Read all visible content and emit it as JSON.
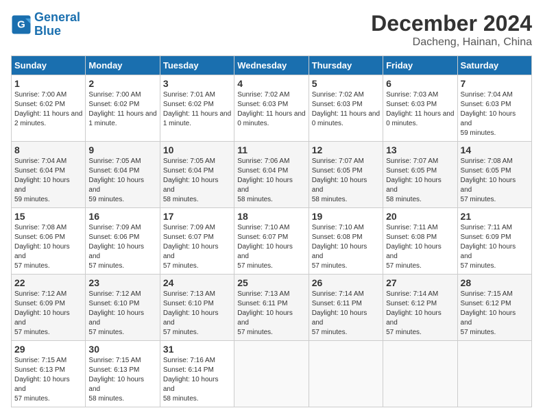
{
  "logo": {
    "line1": "General",
    "line2": "Blue"
  },
  "title": "December 2024",
  "location": "Dacheng, Hainan, China",
  "days_of_week": [
    "Sunday",
    "Monday",
    "Tuesday",
    "Wednesday",
    "Thursday",
    "Friday",
    "Saturday"
  ],
  "weeks": [
    [
      {
        "num": "1",
        "sunrise": "7:00 AM",
        "sunset": "6:02 PM",
        "daylight": "11 hours and 2 minutes."
      },
      {
        "num": "2",
        "sunrise": "7:00 AM",
        "sunset": "6:02 PM",
        "daylight": "11 hours and 1 minute."
      },
      {
        "num": "3",
        "sunrise": "7:01 AM",
        "sunset": "6:02 PM",
        "daylight": "11 hours and 1 minute."
      },
      {
        "num": "4",
        "sunrise": "7:02 AM",
        "sunset": "6:03 PM",
        "daylight": "11 hours and 0 minutes."
      },
      {
        "num": "5",
        "sunrise": "7:02 AM",
        "sunset": "6:03 PM",
        "daylight": "11 hours and 0 minutes."
      },
      {
        "num": "6",
        "sunrise": "7:03 AM",
        "sunset": "6:03 PM",
        "daylight": "11 hours and 0 minutes."
      },
      {
        "num": "7",
        "sunrise": "7:04 AM",
        "sunset": "6:03 PM",
        "daylight": "10 hours and 59 minutes."
      }
    ],
    [
      {
        "num": "8",
        "sunrise": "7:04 AM",
        "sunset": "6:04 PM",
        "daylight": "10 hours and 59 minutes."
      },
      {
        "num": "9",
        "sunrise": "7:05 AM",
        "sunset": "6:04 PM",
        "daylight": "10 hours and 59 minutes."
      },
      {
        "num": "10",
        "sunrise": "7:05 AM",
        "sunset": "6:04 PM",
        "daylight": "10 hours and 58 minutes."
      },
      {
        "num": "11",
        "sunrise": "7:06 AM",
        "sunset": "6:04 PM",
        "daylight": "10 hours and 58 minutes."
      },
      {
        "num": "12",
        "sunrise": "7:07 AM",
        "sunset": "6:05 PM",
        "daylight": "10 hours and 58 minutes."
      },
      {
        "num": "13",
        "sunrise": "7:07 AM",
        "sunset": "6:05 PM",
        "daylight": "10 hours and 58 minutes."
      },
      {
        "num": "14",
        "sunrise": "7:08 AM",
        "sunset": "6:05 PM",
        "daylight": "10 hours and 57 minutes."
      }
    ],
    [
      {
        "num": "15",
        "sunrise": "7:08 AM",
        "sunset": "6:06 PM",
        "daylight": "10 hours and 57 minutes."
      },
      {
        "num": "16",
        "sunrise": "7:09 AM",
        "sunset": "6:06 PM",
        "daylight": "10 hours and 57 minutes."
      },
      {
        "num": "17",
        "sunrise": "7:09 AM",
        "sunset": "6:07 PM",
        "daylight": "10 hours and 57 minutes."
      },
      {
        "num": "18",
        "sunrise": "7:10 AM",
        "sunset": "6:07 PM",
        "daylight": "10 hours and 57 minutes."
      },
      {
        "num": "19",
        "sunrise": "7:10 AM",
        "sunset": "6:08 PM",
        "daylight": "10 hours and 57 minutes."
      },
      {
        "num": "20",
        "sunrise": "7:11 AM",
        "sunset": "6:08 PM",
        "daylight": "10 hours and 57 minutes."
      },
      {
        "num": "21",
        "sunrise": "7:11 AM",
        "sunset": "6:09 PM",
        "daylight": "10 hours and 57 minutes."
      }
    ],
    [
      {
        "num": "22",
        "sunrise": "7:12 AM",
        "sunset": "6:09 PM",
        "daylight": "10 hours and 57 minutes."
      },
      {
        "num": "23",
        "sunrise": "7:12 AM",
        "sunset": "6:10 PM",
        "daylight": "10 hours and 57 minutes."
      },
      {
        "num": "24",
        "sunrise": "7:13 AM",
        "sunset": "6:10 PM",
        "daylight": "10 hours and 57 minutes."
      },
      {
        "num": "25",
        "sunrise": "7:13 AM",
        "sunset": "6:11 PM",
        "daylight": "10 hours and 57 minutes."
      },
      {
        "num": "26",
        "sunrise": "7:14 AM",
        "sunset": "6:11 PM",
        "daylight": "10 hours and 57 minutes."
      },
      {
        "num": "27",
        "sunrise": "7:14 AM",
        "sunset": "6:12 PM",
        "daylight": "10 hours and 57 minutes."
      },
      {
        "num": "28",
        "sunrise": "7:15 AM",
        "sunset": "6:12 PM",
        "daylight": "10 hours and 57 minutes."
      }
    ],
    [
      {
        "num": "29",
        "sunrise": "7:15 AM",
        "sunset": "6:13 PM",
        "daylight": "10 hours and 57 minutes."
      },
      {
        "num": "30",
        "sunrise": "7:15 AM",
        "sunset": "6:13 PM",
        "daylight": "10 hours and 58 minutes."
      },
      {
        "num": "31",
        "sunrise": "7:16 AM",
        "sunset": "6:14 PM",
        "daylight": "10 hours and 58 minutes."
      },
      null,
      null,
      null,
      null
    ]
  ]
}
